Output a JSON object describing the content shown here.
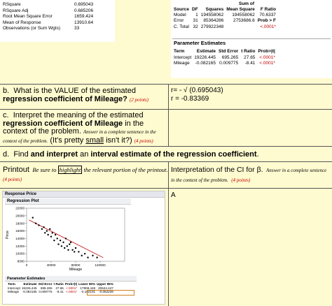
{
  "summary_of_fit": {
    "rows": [
      {
        "label": "RSquare",
        "value": "0.695043"
      },
      {
        "label": "RSquare Adj",
        "value": "0.685206"
      },
      {
        "label": "Root Mean Square Error",
        "value": "1659.424"
      },
      {
        "label": "Mean of Response",
        "value": "13910.64"
      },
      {
        "label": "Observations (or Sum Wgts)",
        "value": "33"
      }
    ]
  },
  "anova": {
    "sum_of": "Sum of",
    "headers": [
      "Source",
      "DF",
      "Squares",
      "Mean Square",
      "F Ratio"
    ],
    "rows": [
      [
        "Model",
        "1",
        "194558062",
        "194558062",
        "70.6337"
      ],
      [
        "Error",
        "31",
        "85364286",
        "2753686.6",
        "Prob > F"
      ],
      [
        "C. Total",
        "32",
        "279922348",
        "",
        "<.0001*"
      ]
    ]
  },
  "param_estimates": {
    "title": "Parameter Estimates",
    "headers": [
      "Term",
      "Estimate",
      "Std Error",
      "t Ratio",
      "Prob>|t|"
    ],
    "rows": [
      [
        "Intercept",
        "19226.445",
        "695.265",
        "27.65",
        "<.0001*"
      ],
      [
        "Mileage",
        "-0.082165",
        "0.009775",
        "-8.41",
        "<.0001*"
      ]
    ]
  },
  "qb": {
    "number": "b.",
    "text_a": "What is the VALUE of the estimated ",
    "text_bold": "regression coefficient of Mileage",
    "text_end": "?",
    "points": "(2 points)",
    "ans1": "r= - √ (0.695043)",
    "ans2": "r = -0.83369"
  },
  "qc": {
    "number": "c.",
    "text_a": "Interpret the meaning of the estimated ",
    "text_bold": "regression coefficient of Mileage",
    "text_b": " in the context of the problem.",
    "hint": "Answer in a complete sentence in the context of the problem.",
    "aside": "(It's pretty ",
    "aside_u": "small",
    "aside_end": " isn't it?)",
    "points": "(4 points)"
  },
  "qd": {
    "number": "d.",
    "text_a": "Find ",
    "text_bold": "and interpret",
    "text_b": " an ",
    "text_bold2": "interval estimate of the regression coefficient",
    "text_end": "."
  },
  "printout": {
    "label": "Printout",
    "hint_a": "Be sure to ",
    "hint_box": "highlight",
    "hint_b": " the relevant portion of the printout.",
    "points": "(4 points)"
  },
  "interp": {
    "label": "Interpretation of the CI for β.",
    "hint": "Answer in a complete sentence in the context of the problem.",
    "points": "(4 points)",
    "answer": "A"
  },
  "jmp": {
    "header": "Response Price",
    "plot_title": "Regression Plot",
    "xlabel": "Mileage",
    "ylabel": "Price",
    "pe_title": "Parameter Estimates",
    "pe_headers": [
      "Term",
      "Estimate",
      "Std Error",
      "t Ratio",
      "Prob>|t|",
      "Lower 95%",
      "Upper 95%"
    ],
    "pe_rows": [
      [
        "Intercept",
        "19226.445",
        "695.265",
        "27.65",
        "<.0001*",
        "17808.448",
        "20644.447"
      ],
      [
        "Mileage",
        "-0.082165",
        "0.009775",
        "-8.41",
        "<.0001*",
        "-0.102101",
        "-0.062228"
      ]
    ]
  },
  "chart_data": {
    "type": "scatter",
    "title": "Regression Plot",
    "xlabel": "Mileage",
    "ylabel": "Price",
    "xlim": [
      0,
      160000
    ],
    "ylim": [
      8000,
      22000
    ],
    "x_ticks": [
      "0",
      "40000",
      "80000",
      "120000"
    ],
    "y_ticks": [
      "8000",
      "10000",
      "12000",
      "14000",
      "16000",
      "18000",
      "20000",
      "22000"
    ],
    "fit_line": {
      "intercept": 19226.445,
      "slope": -0.082165,
      "color": "#c00000"
    },
    "point_color": "#000000",
    "x": [
      10000,
      15000,
      20000,
      25000,
      28000,
      30000,
      33000,
      35000,
      38000,
      40000,
      42000,
      45000,
      47000,
      50000,
      52000,
      55000,
      57000,
      60000,
      62000,
      64000,
      66000,
      68000,
      70000,
      72000,
      75000,
      78000,
      80000,
      85000,
      90000,
      95000,
      100000,
      108000,
      115000
    ],
    "y": [
      19500,
      18000,
      17500,
      16500,
      17000,
      15500,
      16000,
      15000,
      16500,
      14500,
      15500,
      13500,
      15000,
      14000,
      12500,
      13500,
      12000,
      13000,
      11500,
      14000,
      12000,
      11000,
      12500,
      13000,
      11000,
      10500,
      11500,
      10500,
      9500,
      10000,
      9000,
      9500,
      9000
    ]
  }
}
